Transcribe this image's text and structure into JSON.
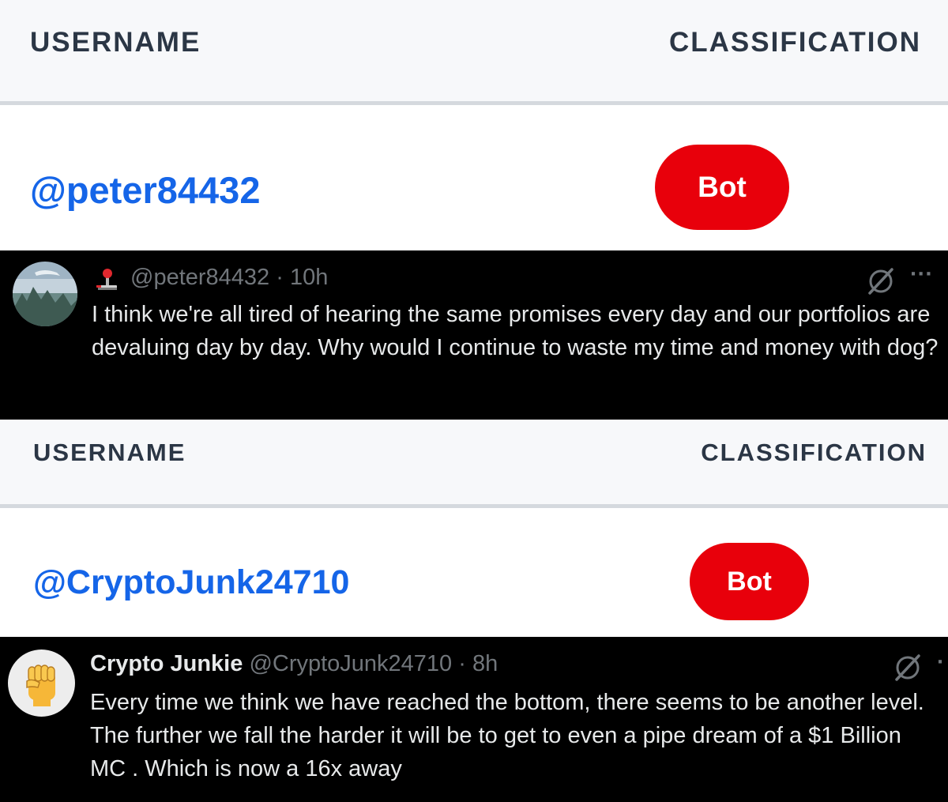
{
  "table1": {
    "username_header": "USERNAME",
    "classification_header": "CLASSIFICATION",
    "username": "@peter84432",
    "classification": "Bot"
  },
  "tweet1": {
    "handle": "@peter84432",
    "separator": "·",
    "time": "10h",
    "text": "I think we're all tired of hearing the same promises every day and our portfolios are devaluing day by day. Why would I continue to waste my time and money with dog?",
    "more": "···",
    "avatar_icon": "landscape-avatar",
    "badge_icon": "joystick-icon"
  },
  "table2": {
    "username_header": "USERNAME",
    "classification_header": "CLASSIFICATION",
    "username": "@CryptoJunk24710",
    "classification": "Bot"
  },
  "tweet2": {
    "display_name": "Crypto Junkie",
    "handle": "@CryptoJunk24710",
    "separator": "·",
    "time": "8h",
    "text": "Every time we think we have reached the bottom, there seems to be another level. The further we fall the harder it will be to get to even a pipe dream of a $1 Billion MC . Which is now a 16x away",
    "more": "·",
    "avatar_icon": "raised-fist-emoji"
  },
  "colors": {
    "username_blue": "#1565e8",
    "bot_red": "#e8000b",
    "header_bg": "#f7f8fa",
    "tweet_bg": "#000000"
  }
}
